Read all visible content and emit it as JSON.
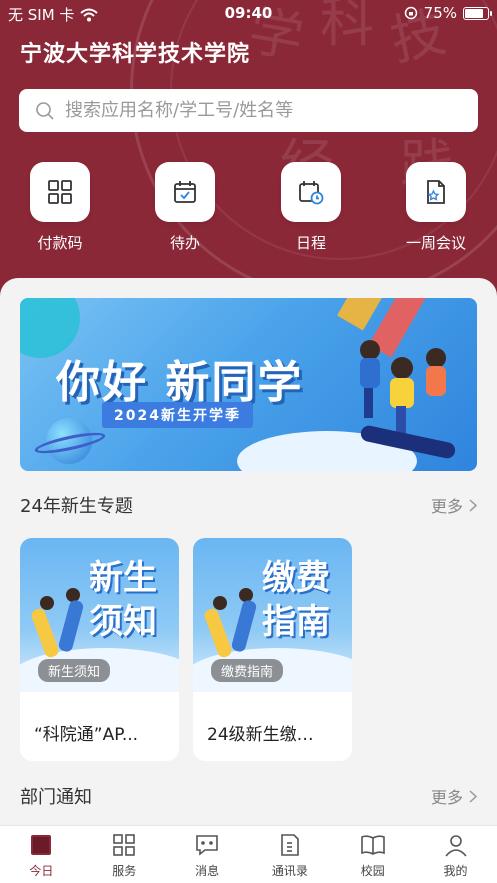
{
  "status": {
    "carrier": "无 SIM 卡",
    "time": "09:40",
    "battery": "75%",
    "battery_level": 0.75
  },
  "header": {
    "title": "宁波大学科学技术学院"
  },
  "search": {
    "placeholder": "搜索应用名称/学工号/姓名等"
  },
  "quick_actions": [
    {
      "label": "付款码",
      "icon": "qr-code-icon"
    },
    {
      "label": "待办",
      "icon": "todo-calendar-icon"
    },
    {
      "label": "日程",
      "icon": "schedule-icon"
    },
    {
      "label": "一周会议",
      "icon": "meeting-doc-icon"
    }
  ],
  "banner": {
    "title": "你好 新同学",
    "subtitle": "2024新生开学季"
  },
  "section_freshman": {
    "title": "24年新生专题",
    "more": "更多"
  },
  "cards": [
    {
      "art_text": "新生须知",
      "tag": "新生须知",
      "caption": "“科院通”AP..."
    },
    {
      "art_text": "缴费指南",
      "tag": "缴费指南",
      "caption": "24级新生缴…"
    }
  ],
  "section_notice": {
    "title": "部门通知",
    "more": "更多"
  },
  "tabs": [
    {
      "label": "今日",
      "active": true
    },
    {
      "label": "服务"
    },
    {
      "label": "消息"
    },
    {
      "label": "通讯录"
    },
    {
      "label": "校园"
    },
    {
      "label": "我的"
    }
  ],
  "colors": {
    "brand": "#8b2838",
    "banner_blue": "#4aa3ea"
  }
}
